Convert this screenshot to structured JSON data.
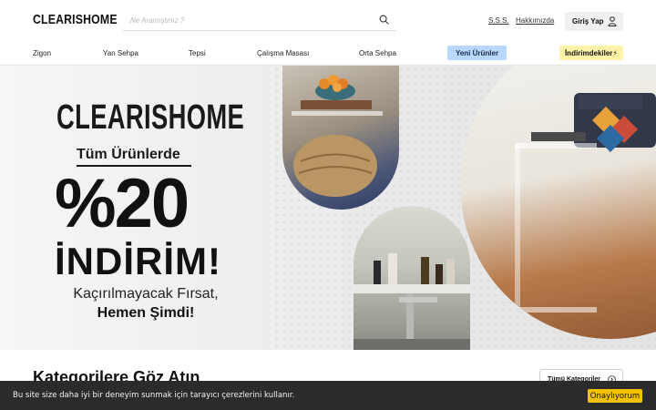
{
  "header": {
    "logo": "CLEARISHOME",
    "search_placeholder": "Ne Aramıştınız ?",
    "links": [
      "S.S.S.",
      "Hakkımızda"
    ],
    "login_label": "Giriş Yap"
  },
  "nav": {
    "items": [
      "Zigon",
      "Yan Sehpa",
      "Tepsi",
      "Çalışma Masası",
      "Orta Sehpa"
    ],
    "new_label": "Yeni Ürünler",
    "sale_label": "İndirimdekiler⚡"
  },
  "hero": {
    "brand": "CLEARISHOME",
    "subtitle": "Tüm Ürünlerde",
    "percent": "%20",
    "discount": "İNDİRİM!",
    "line1": "Kaçırılmayacak Fırsat,",
    "line2": "Hemen Şimdi!"
  },
  "section": {
    "title": "Kategorilere Göz Atın",
    "all_label": "Tümü Kategoriler"
  },
  "cookie": {
    "text": "Bu site size daha iyi bir deneyim sunmak için tarayıcı çerezlerini kullanır.",
    "accept_label": "Onaylıyorum"
  },
  "colors": {
    "accent_blue": "#b9d8ff",
    "accent_yellow": "#fff3a8",
    "cookie_button": "#f2c200",
    "cookie_bar": "#2b2b2b"
  },
  "icons": [
    "search-icon",
    "user-icon",
    "arrow-circle-icon"
  ]
}
